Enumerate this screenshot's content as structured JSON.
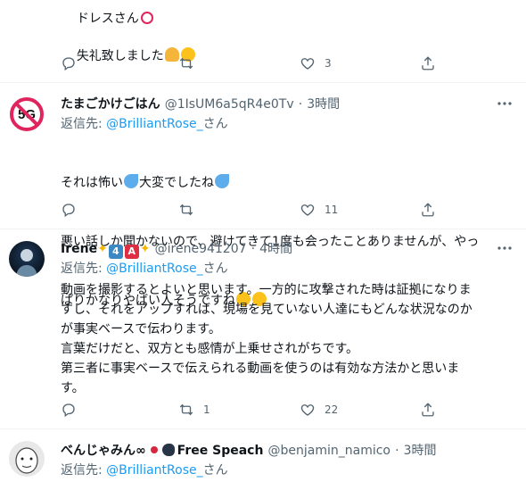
{
  "tweet0": {
    "line_partial": "ドレスさん",
    "body": "失礼致しました",
    "likes": "3"
  },
  "tweet1": {
    "name": "たまごかけごはん",
    "handle": "@1IsUM6a5qR4e0Tv",
    "dot": "·",
    "time": "3時間",
    "reply_prefix": "返信先: ",
    "reply_user": "@BrilliantRose_",
    "reply_suffix": "さん",
    "line1a": "それは怖い",
    "line1b": "大変でしたね",
    "line2": "悪い話しか聞かないので、避けてきて1度も会ったことありませんが、やっ",
    "line3": "ぱりかなりやばい人そうですね",
    "likes": "11",
    "avatar_text": "5G"
  },
  "tweet2": {
    "name": "Irene",
    "badge1": "4",
    "badge2": "A",
    "handle": "@irene941207",
    "dot": "·",
    "time": "4時間",
    "reply_prefix": "返信先: ",
    "reply_user": "@BrilliantRose_",
    "reply_suffix": "さん",
    "body": "動画を撮影するとよいと思います。一方的に攻撃された時は証拠になりま\nすし、それをアップすれば、現場を見ていない人達にもどんな状況なのか\nが事実ベースで伝わります。\n言葉だけだと、双方とも感情が上乗せされがちです。\n第三者に事実ベースで伝えられる動画を使うのは有効な方法かと思いま\nす。",
    "retweets": "1",
    "likes": "22"
  },
  "tweet3": {
    "name": "べんじゃみん∞",
    "name_suffix": "Free Speach",
    "handle": "@benjamin_namico",
    "dot": "·",
    "time": "3時間",
    "reply_prefix": "返信先: ",
    "reply_user": "@BrilliantRose_",
    "reply_suffix": "さん"
  },
  "colors": {
    "link": "#1d9bf0",
    "secondary": "#536471",
    "divider": "#eff3f4"
  },
  "icons": [
    "reply-icon",
    "retweet-icon",
    "like-icon",
    "share-icon",
    "more-icon",
    "verified-ok-icon"
  ]
}
